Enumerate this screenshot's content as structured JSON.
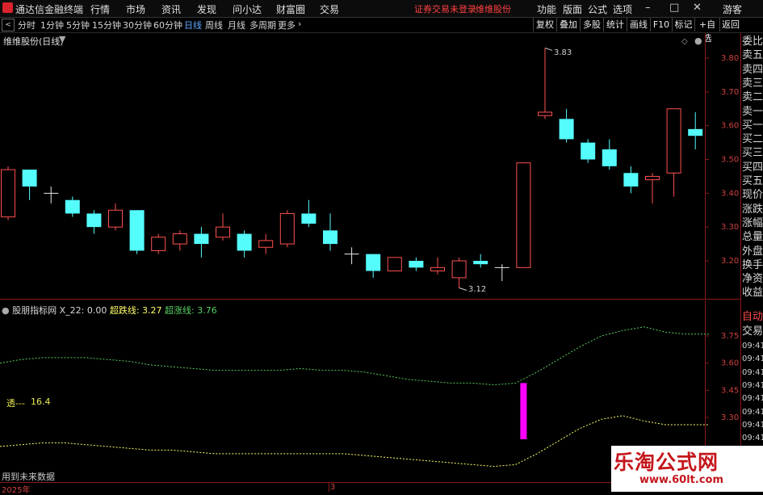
{
  "titlebar": {
    "app_title": "通达信金融终端",
    "menus": [
      "行情",
      "市场",
      "资讯",
      "发现",
      "问小达",
      "财富圈",
      "交易"
    ],
    "center_note": "证券交易未登录",
    "center_stock": "维维股份",
    "right_menus": [
      "功能",
      "版面",
      "公式",
      "选项"
    ],
    "guest": "游客"
  },
  "toolbar": {
    "periods": [
      "分时",
      "1分钟",
      "5分钟",
      "15分钟",
      "30分钟",
      "60分钟",
      "日线",
      "周线",
      "月线",
      "多周期",
      "更多"
    ],
    "active_period": "日线",
    "right_buttons": [
      "复权",
      "叠加",
      "多股",
      "统计",
      "画线",
      "F10",
      "标记",
      "+自选",
      "返回"
    ]
  },
  "main_chart": {
    "title": "维维股份(日线)",
    "high_label": "3.83",
    "low_label": "3.12",
    "y_ticks": [
      "3.80",
      "3.70",
      "3.60",
      "3.50",
      "3.40",
      "3.30",
      "3.20"
    ]
  },
  "indicator": {
    "name": "股朋指标网",
    "x22": "X_22: 0.00",
    "line1_label": "超跌线: 3.27",
    "line2_label": "超涨线: 3.76",
    "left_label": "透---",
    "left_value": "16.4",
    "footer_note": "用到未来数据",
    "y_ticks": [
      "3.75",
      "3.60",
      "3.45",
      "3.30"
    ]
  },
  "side_panel": {
    "items": [
      "委比",
      "卖五",
      "卖四",
      "卖三",
      "卖二",
      "卖一",
      "买一",
      "买二",
      "买三",
      "买四",
      "买五",
      "现价",
      "涨跌",
      "涨幅",
      "总量",
      "外盘",
      "换手",
      "净资",
      "收益"
    ],
    "auto": "自动",
    "trade": "交易",
    "times": [
      "09:41",
      "09:41",
      "09:41",
      "09:41",
      "09:41",
      "09:41",
      "09:41",
      "09:41"
    ]
  },
  "bottom_axis": {
    "year_label": "2025年",
    "month_label": "3"
  },
  "watermark": {
    "title": "乐淘公式网",
    "url": "www.60lt.com"
  },
  "colors": {
    "up": "#ff4f4f",
    "down": "#54fcfc",
    "overbought_line": "#58d060",
    "oversold_line": "#ffff66",
    "signal_bar": "#ff00ff"
  },
  "candles": [
    {
      "o": 3.33,
      "c": 3.47,
      "h": 3.48,
      "l": 3.32
    },
    {
      "o": 3.47,
      "c": 3.42,
      "h": 3.47,
      "l": 3.38
    },
    {
      "o": 3.4,
      "c": 3.4,
      "h": 3.42,
      "l": 3.37
    },
    {
      "o": 3.38,
      "c": 3.34,
      "h": 3.39,
      "l": 3.33
    },
    {
      "o": 3.34,
      "c": 3.3,
      "h": 3.35,
      "l": 3.28
    },
    {
      "o": 3.3,
      "c": 3.35,
      "h": 3.37,
      "l": 3.29
    },
    {
      "o": 3.35,
      "c": 3.23,
      "h": 3.35,
      "l": 3.22
    },
    {
      "o": 3.23,
      "c": 3.27,
      "h": 3.28,
      "l": 3.22
    },
    {
      "o": 3.25,
      "c": 3.28,
      "h": 3.29,
      "l": 3.23
    },
    {
      "o": 3.28,
      "c": 3.25,
      "h": 3.3,
      "l": 3.21
    },
    {
      "o": 3.27,
      "c": 3.3,
      "h": 3.34,
      "l": 3.26
    },
    {
      "o": 3.28,
      "c": 3.23,
      "h": 3.29,
      "l": 3.21
    },
    {
      "o": 3.24,
      "c": 3.26,
      "h": 3.28,
      "l": 3.22
    },
    {
      "o": 3.25,
      "c": 3.34,
      "h": 3.35,
      "l": 3.24
    },
    {
      "o": 3.34,
      "c": 3.31,
      "h": 3.38,
      "l": 3.3
    },
    {
      "o": 3.29,
      "c": 3.25,
      "h": 3.34,
      "l": 3.23
    },
    {
      "o": 3.22,
      "c": 3.22,
      "h": 3.24,
      "l": 3.19
    },
    {
      "o": 3.22,
      "c": 3.17,
      "h": 3.22,
      "l": 3.15
    },
    {
      "o": 3.17,
      "c": 3.21,
      "h": 3.21,
      "l": 3.17
    },
    {
      "o": 3.2,
      "c": 3.18,
      "h": 3.21,
      "l": 3.17
    },
    {
      "o": 3.17,
      "c": 3.18,
      "h": 3.21,
      "l": 3.16
    },
    {
      "o": 3.15,
      "c": 3.2,
      "h": 3.21,
      "l": 3.12
    },
    {
      "o": 3.2,
      "c": 3.19,
      "h": 3.22,
      "l": 3.18
    },
    {
      "o": 3.18,
      "c": 3.18,
      "h": 3.19,
      "l": 3.14
    },
    {
      "o": 3.18,
      "c": 3.49,
      "h": 3.49,
      "l": 3.18
    },
    {
      "o": 3.63,
      "c": 3.64,
      "h": 3.83,
      "l": 3.62
    },
    {
      "o": 3.62,
      "c": 3.56,
      "h": 3.65,
      "l": 3.55
    },
    {
      "o": 3.55,
      "c": 3.5,
      "h": 3.56,
      "l": 3.49
    },
    {
      "o": 3.53,
      "c": 3.48,
      "h": 3.56,
      "l": 3.47
    },
    {
      "o": 3.46,
      "c": 3.42,
      "h": 3.48,
      "l": 3.4
    },
    {
      "o": 3.44,
      "c": 3.45,
      "h": 3.46,
      "l": 3.37
    },
    {
      "o": 3.46,
      "c": 3.65,
      "h": 3.65,
      "l": 3.39
    },
    {
      "o": 3.59,
      "c": 3.57,
      "h": 3.64,
      "l": 3.53
    }
  ],
  "overbought": [
    3.6,
    3.62,
    3.63,
    3.63,
    3.63,
    3.62,
    3.61,
    3.59,
    3.58,
    3.57,
    3.56,
    3.56,
    3.56,
    3.56,
    3.57,
    3.56,
    3.56,
    3.55,
    3.53,
    3.51,
    3.5,
    3.49,
    3.49,
    3.48,
    3.49,
    3.55,
    3.62,
    3.69,
    3.75,
    3.78,
    3.8,
    3.77,
    3.76,
    3.76
  ],
  "oversold": [
    3.14,
    3.15,
    3.16,
    3.16,
    3.15,
    3.14,
    3.13,
    3.12,
    3.12,
    3.11,
    3.1,
    3.1,
    3.1,
    3.1,
    3.1,
    3.1,
    3.1,
    3.09,
    3.08,
    3.07,
    3.06,
    3.05,
    3.04,
    3.03,
    3.04,
    3.1,
    3.17,
    3.24,
    3.29,
    3.31,
    3.28,
    3.26,
    3.26,
    3.26
  ]
}
